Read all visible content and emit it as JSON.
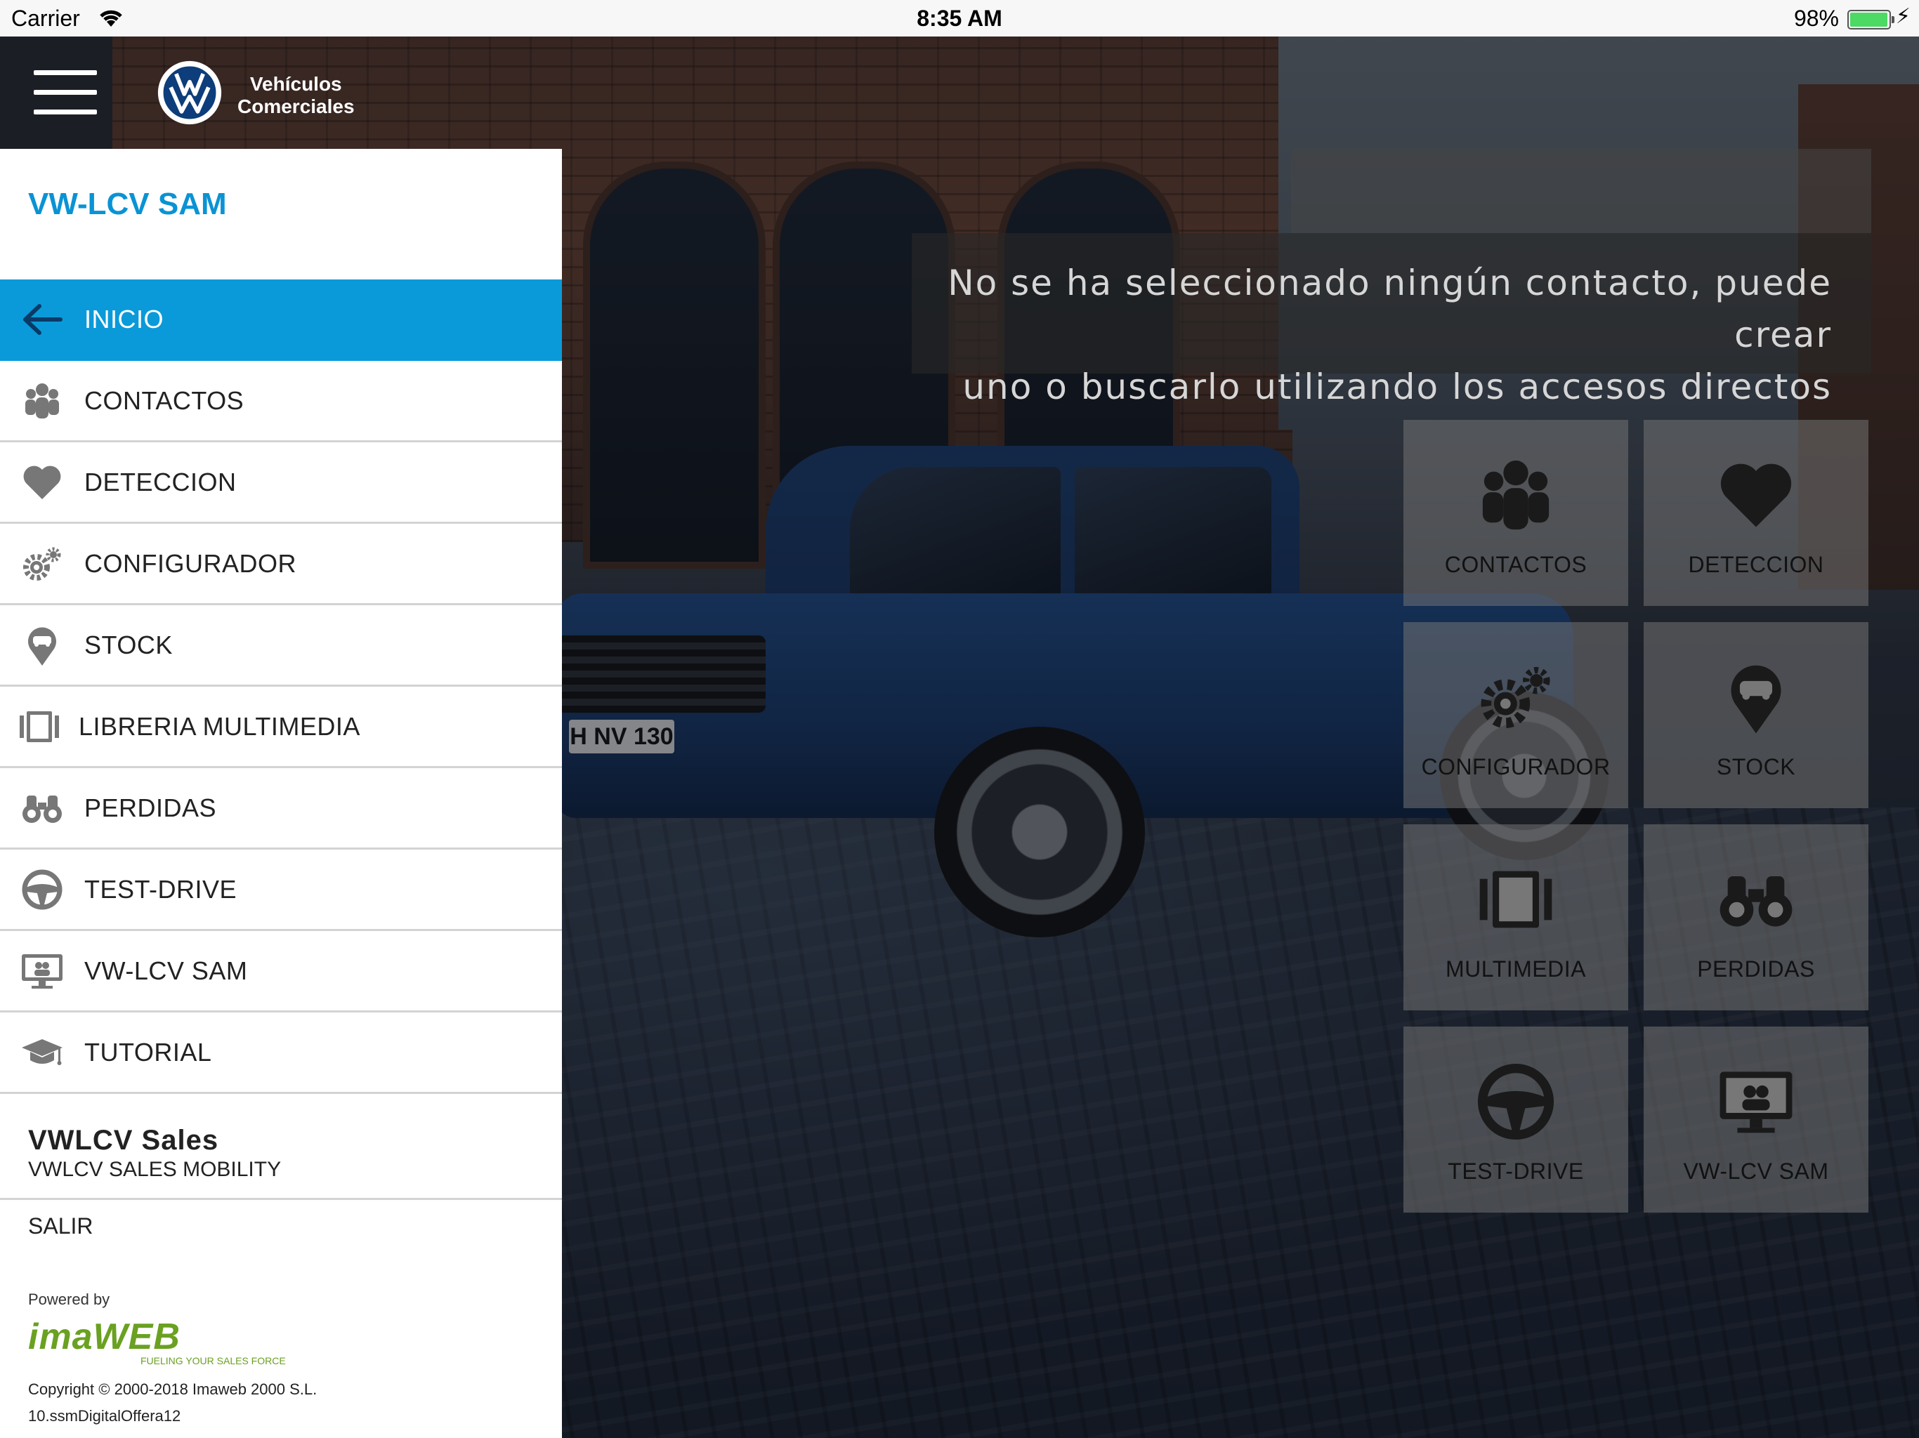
{
  "status_bar": {
    "carrier": "Carrier",
    "time": "8:35 AM",
    "battery_percent": "98%",
    "battery_level": 0.98,
    "icons": [
      "wifi-icon",
      "battery-icon",
      "charging-bolt-icon"
    ]
  },
  "header": {
    "menu_icon": "hamburger-menu-icon",
    "logo_icon": "vw-logo-icon",
    "brand_line1": "Vehículos",
    "brand_line2": "Comerciales"
  },
  "sidebar": {
    "app_title": "VW-LCV SAM",
    "items": [
      {
        "label": "INICIO",
        "icon": "back-arrow-icon",
        "active": true
      },
      {
        "label": "CONTACTOS",
        "icon": "people-group-icon"
      },
      {
        "label": "DETECCION",
        "icon": "heart-icon"
      },
      {
        "label": "CONFIGURADOR",
        "icon": "gears-icon"
      },
      {
        "label": "STOCK",
        "icon": "car-pin-icon"
      },
      {
        "label": "LIBRERIA MULTIMEDIA",
        "icon": "film-icon"
      },
      {
        "label": "PERDIDAS",
        "icon": "binoculars-icon"
      },
      {
        "label": "TEST-DRIVE",
        "icon": "steering-wheel-icon"
      },
      {
        "label": "VW-LCV SAM",
        "icon": "monitor-icon"
      },
      {
        "label": "TUTORIAL",
        "icon": "graduation-cap-icon"
      }
    ],
    "user_name": "VWLCV Sales",
    "user_subtitle": "VWLCV SALES MOBILITY",
    "logout": "SALIR",
    "powered_by": "Powered by",
    "imaweb_name": "imaWEB",
    "imaweb_tagline": "FUELING YOUR SALES FORCE",
    "copyright": "Copyright © 2000-2018 Imaweb 2000 S.L.",
    "version": "10.ssmDigitalOffera12"
  },
  "message": {
    "line1": "No se ha seleccionado ningún contacto, puede crear",
    "line2": "uno o buscarlo utilizando los accesos directos"
  },
  "shortcuts": [
    {
      "label": "CONTACTOS",
      "icon": "people-group-icon"
    },
    {
      "label": "DETECCION",
      "icon": "heart-icon"
    },
    {
      "label": "CONFIGURADOR",
      "icon": "gears-icon"
    },
    {
      "label": "STOCK",
      "icon": "car-pin-icon"
    },
    {
      "label": "MULTIMEDIA",
      "icon": "film-icon"
    },
    {
      "label": "PERDIDAS",
      "icon": "binoculars-icon"
    },
    {
      "label": "TEST-DRIVE",
      "icon": "steering-wheel-icon"
    },
    {
      "label": "VW-LCV SAM",
      "icon": "monitor-icon"
    }
  ],
  "background": {
    "plate_text": "H NV 130"
  },
  "colors": {
    "accent": "#0a9ad9",
    "title": "#0a93d4",
    "tile_bg": "#737373",
    "imaweb_green": "#6aa121"
  }
}
